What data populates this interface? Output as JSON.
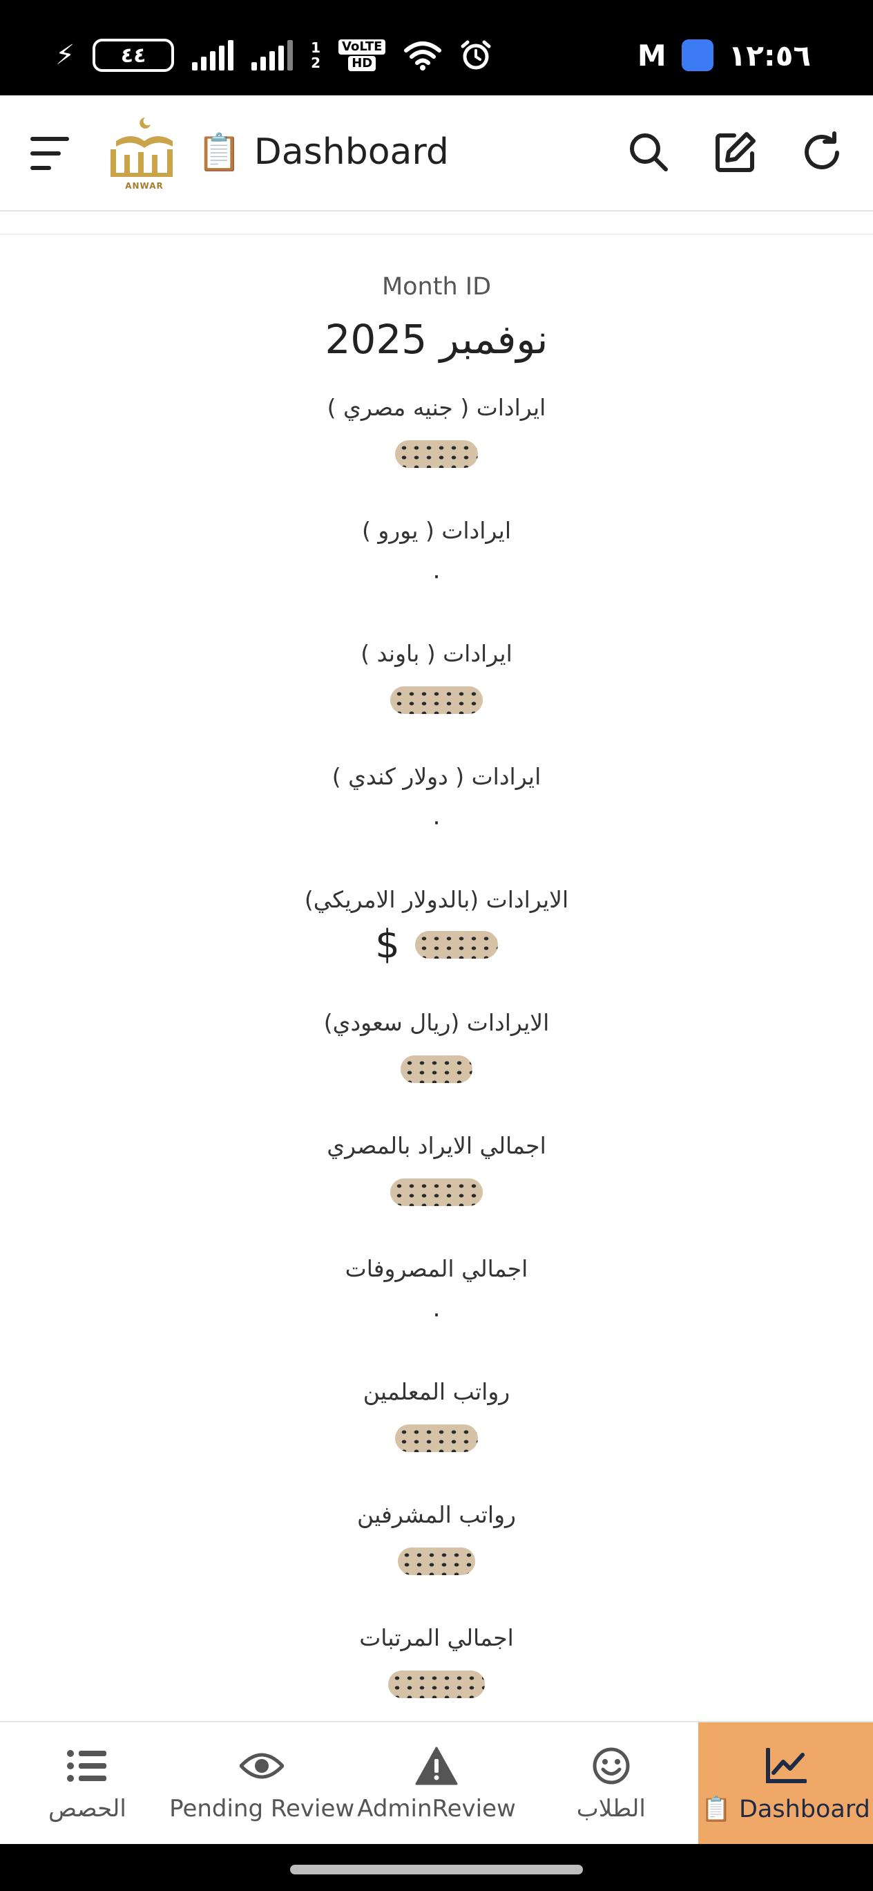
{
  "status_bar": {
    "battery": "٤٤",
    "sim_slots": [
      "1",
      "2"
    ],
    "volte_badge": "VoLTE",
    "hd_badge": "HD",
    "time": "١٢:٥٦",
    "icons": [
      "charging-bolt-icon",
      "battery-icon",
      "signal-icon",
      "signal-icon",
      "wifi-icon",
      "alarm-icon",
      "gmail-icon",
      "app-notification-icon"
    ]
  },
  "app_bar": {
    "logo_text": "ANWAR",
    "title_icon": "📋",
    "title": "Dashboard",
    "actions": [
      "search-icon",
      "edit-icon",
      "refresh-icon"
    ]
  },
  "content": {
    "month_label": "Month ID",
    "month_value": "نوفمبر 2025",
    "metrics": [
      {
        "label": "ايرادات ( جنيه مصري )",
        "value": ""
      },
      {
        "label": "ايرادات ( يورو )",
        "value": "٠"
      },
      {
        "label": "ايرادات ( باوند )",
        "value": ""
      },
      {
        "label": "ايرادات ( دولار كندي )",
        "value": "٠"
      },
      {
        "label": "الايرادات (بالدولار الامريكي)",
        "value": "",
        "currency_symbol": "$"
      },
      {
        "label": "الايرادات (ريال سعودي)",
        "value": ""
      },
      {
        "label": "اجمالي الايراد بالمصري",
        "value": ""
      },
      {
        "label": "اجمالي المصروفات",
        "value": "٠"
      },
      {
        "label": "رواتب المعلمين",
        "value": ""
      },
      {
        "label": "رواتب المشرفين",
        "value": ""
      },
      {
        "label": "اجمالي المرتبات",
        "value": ""
      }
    ]
  },
  "bottom_nav": {
    "items": [
      {
        "label": "الحصص",
        "icon": "list-icon",
        "active": false
      },
      {
        "label": "Pending Review",
        "icon": "eye-icon",
        "active": false
      },
      {
        "label": "AdminReview",
        "icon": "warning-icon",
        "active": false
      },
      {
        "label": "الطلاب",
        "icon": "smiley-icon",
        "active": false
      },
      {
        "label": "📋 Dashboard",
        "icon": "chart-icon",
        "active": true
      }
    ]
  },
  "colors": {
    "active_tab": "#f0a868",
    "status_bar": "#000000",
    "logo_gold": "#c9a44a"
  }
}
